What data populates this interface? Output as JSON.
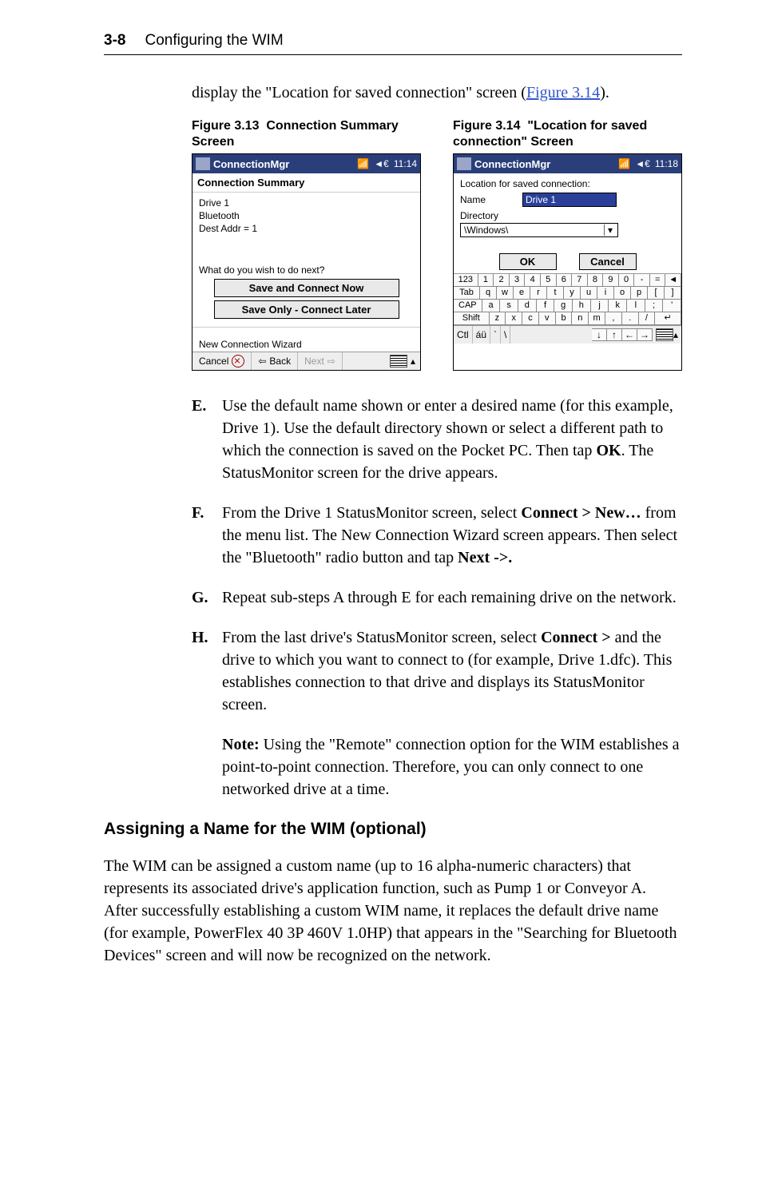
{
  "header": {
    "page_number": "3-8",
    "chapter": "Configuring the WIM"
  },
  "intro": {
    "prefix": "display the \"Location for saved connection\" screen (",
    "link": "Figure 3.14",
    "suffix": ")."
  },
  "figures": {
    "left": {
      "num": "Figure 3.13",
      "title": "Connection Summary Screen"
    },
    "right": {
      "num": "Figure 3.14",
      "title": "\"Location for saved connection\" Screen"
    }
  },
  "shot_left": {
    "app_title": "ConnectionMgr",
    "clock": "11:14",
    "subheader": "Connection Summary",
    "lines": [
      "Drive 1",
      "Bluetooth",
      "Dest Addr = 1"
    ],
    "prompt": "What do you wish to do next?",
    "btn1": "Save and Connect Now",
    "btn2": "Save Only - Connect Later",
    "status": "New Connection Wizard",
    "bottom": {
      "cancel": "Cancel",
      "back": "Back",
      "next": "Next"
    }
  },
  "shot_right": {
    "app_title": "ConnectionMgr",
    "clock": "11:18",
    "heading": "Location for saved connection:",
    "name_label": "Name",
    "name_value": "Drive 1",
    "dir_label": "Directory",
    "dir_value": "\\Windows\\",
    "ok": "OK",
    "cancel": "Cancel",
    "osk": {
      "r1": [
        "123",
        "1",
        "2",
        "3",
        "4",
        "5",
        "6",
        "7",
        "8",
        "9",
        "0",
        "-",
        "=",
        "◄"
      ],
      "r2": [
        "Tab",
        "q",
        "w",
        "e",
        "r",
        "t",
        "y",
        "u",
        "i",
        "o",
        "p",
        "[",
        "]"
      ],
      "r3": [
        "CAP",
        "a",
        "s",
        "d",
        "f",
        "g",
        "h",
        "j",
        "k",
        "l",
        ";",
        "'"
      ],
      "r4": [
        "Shift",
        "z",
        "x",
        "c",
        "v",
        "b",
        "n",
        "m",
        ",",
        ".",
        "/",
        "↵"
      ]
    },
    "ctl": {
      "ctl": "Ctl",
      "au": "áü",
      "slash": "\\"
    }
  },
  "steps": {
    "E": "Use the default name shown or enter a desired name (for this example, Drive 1). Use the default directory shown or select a different path to which the connection is saved on the Pocket PC. Then tap <b>OK</b>. The StatusMonitor screen for the drive appears.",
    "F": "From the Drive 1 StatusMonitor screen, select <b>Connect > New…</b> from the menu list. The New Connection Wizard screen appears. Then select the \"Bluetooth\" radio button and tap <b>Next -&gt;.</b>",
    "G": "Repeat sub-steps A through E for each remaining drive on the network.",
    "H": "From the last drive's StatusMonitor screen, select <b>Connect &gt;</b> and the drive to which you want to connect to (for example, Drive 1.dfc). This establishes connection to that drive and displays its StatusMonitor screen."
  },
  "note": "<b>Note:</b> Using the \"Remote\" connection option for the WIM establishes a point-to-point connection. Therefore, you can only connect to one networked drive at a time.",
  "section": {
    "heading": "Assigning a Name for the WIM (optional)",
    "para": "The WIM can be assigned a custom name (up to 16 alpha-numeric characters) that represents its associated drive's application function, such as Pump 1 or Conveyor A. After successfully establishing a custom WIM name, it replaces the default drive name (for example, PowerFlex 40 3P 460V 1.0HP) that appears in the \"Searching for Bluetooth Devices\" screen and will now be recognized on the network."
  }
}
